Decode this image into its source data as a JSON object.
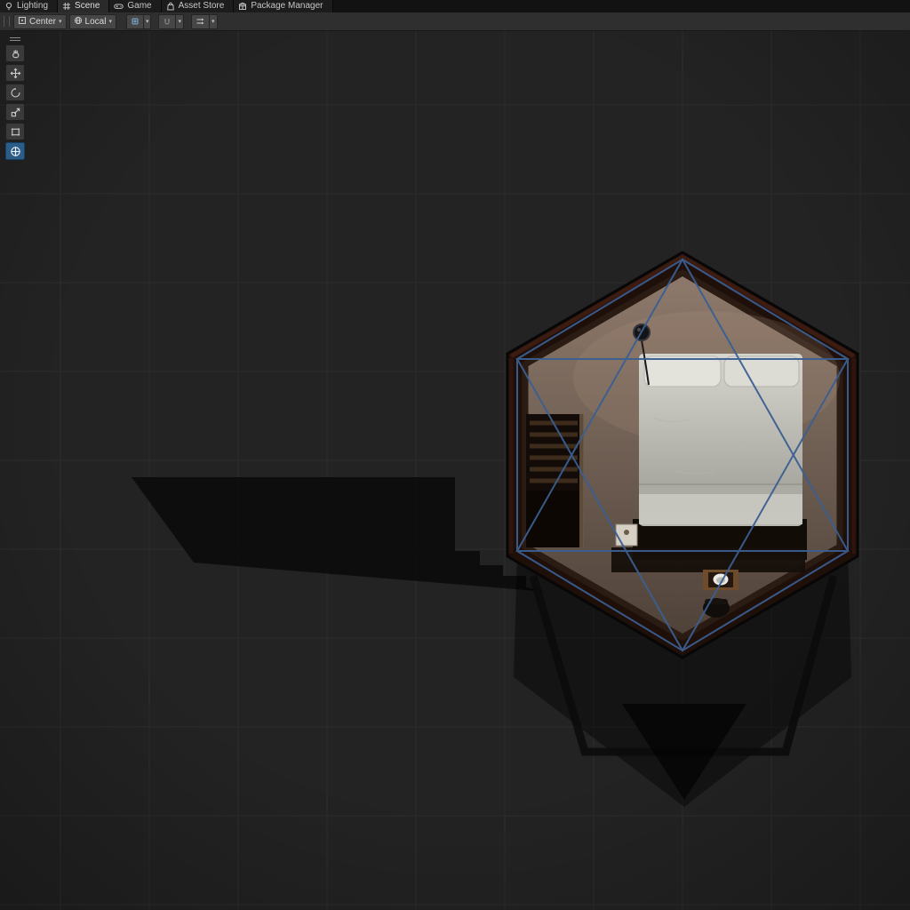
{
  "window": {
    "tabs": [
      {
        "label": "Lighting",
        "icon": "lightbulb-icon",
        "active": false
      },
      {
        "label": "Scene",
        "icon": "scene-grid-icon",
        "active": true
      },
      {
        "label": "Game",
        "icon": "gamepad-icon",
        "active": false
      },
      {
        "label": "Asset Store",
        "icon": "shopping-bag-icon",
        "active": false
      },
      {
        "label": "Package Manager",
        "icon": "package-icon",
        "active": false
      }
    ]
  },
  "scene_toolbar": {
    "pivot_label": "Center",
    "orientation_label": "Local",
    "dropdown_arrow": "▾",
    "toggles": [
      "grid-snapping",
      "snap-toggle",
      "snap-increment"
    ]
  },
  "tools": {
    "items": [
      "hand",
      "move",
      "rotate",
      "scale",
      "rect",
      "transform"
    ],
    "active": "transform"
  },
  "colors": {
    "selection_outline": "#3a5f93",
    "active_tool_background": "#2c5d87",
    "scene_background": "#232323",
    "grid_line": "#2e2e2e",
    "structure_frame": "#1f0f09",
    "floor": "#8e7a6c",
    "bed": "#d6d5ce"
  }
}
